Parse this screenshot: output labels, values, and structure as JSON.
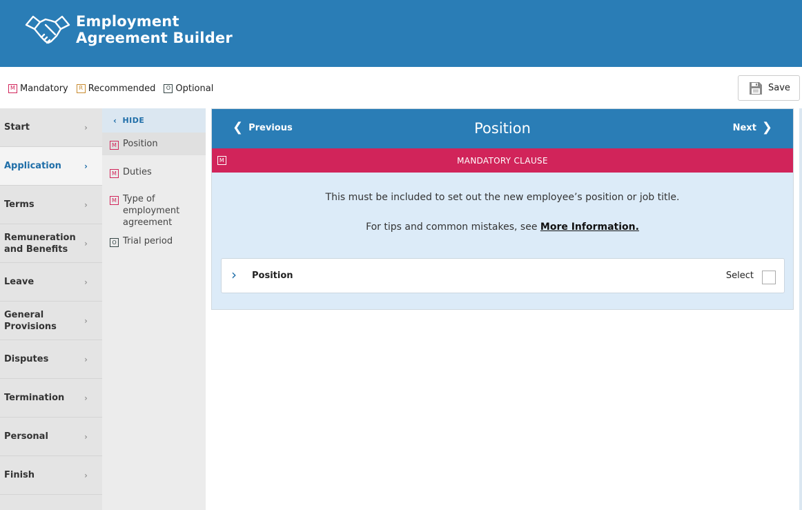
{
  "header": {
    "title_line1": "Employment",
    "title_line2": "Agreement Builder",
    "logo_icon": "handshake-icon"
  },
  "legend": {
    "mandatory": {
      "badge": "M",
      "label": "Mandatory"
    },
    "recommended": {
      "badge": "R",
      "label": "Recommended"
    },
    "optional": {
      "badge": "O",
      "label": "Optional"
    }
  },
  "toolbar": {
    "save_label": "Save"
  },
  "sections": [
    {
      "label": "Start"
    },
    {
      "label": "Application"
    },
    {
      "label": "Terms"
    },
    {
      "label": "Remuneration and Benefits"
    },
    {
      "label": "Leave"
    },
    {
      "label": "General Provisions"
    },
    {
      "label": "Disputes"
    },
    {
      "label": "Termination"
    },
    {
      "label": "Personal"
    },
    {
      "label": "Finish"
    }
  ],
  "clause_panel": {
    "hide_label": "HIDE",
    "items": [
      {
        "badge": "M",
        "label": "Position"
      },
      {
        "badge": "M",
        "label": "Duties"
      },
      {
        "badge": "M",
        "label": "Type of employment agreement"
      },
      {
        "badge": "O",
        "label": "Trial period"
      }
    ]
  },
  "main": {
    "prev_label": "Previous",
    "next_label": "Next",
    "title": "Position",
    "clause_type": "MANDATORY CLAUSE",
    "clause_badge": "M",
    "description": "This must be included to set out the new employee’s position or job title.",
    "tips_prefix": "For tips and common mistakes, see ",
    "tips_link": "More Information.",
    "card": {
      "label": "Position",
      "select_label": "Select",
      "selected": false
    }
  },
  "colors": {
    "brand_blue": "#2a7db6",
    "mandatory": "#d1245a",
    "recommended": "#c88a2e",
    "panel_bg": "#dcebf8"
  }
}
